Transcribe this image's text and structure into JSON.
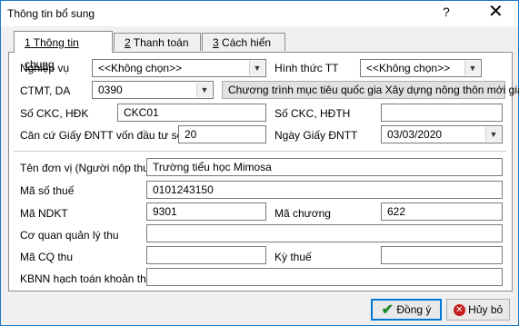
{
  "window": {
    "title": "Thông tin bổ sung",
    "help_glyph": "?",
    "close_glyph": "✕"
  },
  "tabs": [
    {
      "num": "1",
      "label": " Thông tin chung"
    },
    {
      "num": "2",
      "label": " Thanh toán"
    },
    {
      "num": "3",
      "label": " Cách hiển thị"
    }
  ],
  "form": {
    "nghiep_vu": {
      "label": "Nghiệp vụ",
      "value": "<<Không chọn>>"
    },
    "hinh_thuc_tt": {
      "label": "Hình thức TT",
      "value": "<<Không chọn>>"
    },
    "ctmt_da": {
      "label": "CTMT, DA",
      "value": "0390",
      "desc": "Chương trình mục tiêu quốc gia Xây dựng nông thôn mới gia"
    },
    "so_ckc_hdk": {
      "label": "Số CKC, HĐK",
      "value": "CKC01"
    },
    "so_ckc_hdth": {
      "label": "Số CKC, HĐTH",
      "value": ""
    },
    "can_cu": {
      "label": "Căn cứ Giấy ĐNTT vốn đầu tư số",
      "value": "20"
    },
    "ngay_giay": {
      "label": "Ngày Giấy ĐNTT",
      "value": "03/03/2020"
    },
    "ten_don_vi": {
      "label": "Tên đơn vị (Người nộp thuế)",
      "value": "Trường tiểu học Mimosa"
    },
    "ma_so_thue": {
      "label": "Mã số thuế",
      "value": "0101243150"
    },
    "ma_ndkt": {
      "label": "Mã NDKT",
      "value": "9301"
    },
    "ma_chuong": {
      "label": "Mã chương",
      "value": "622"
    },
    "co_quan": {
      "label": "Cơ quan quản lý thu",
      "value": ""
    },
    "ma_cq_thu": {
      "label": "Mã CQ thu",
      "value": ""
    },
    "ky_thue": {
      "label": "Kỳ thuế",
      "value": ""
    },
    "kbnn": {
      "label": "KBNN hạch toán khoản thu",
      "value": ""
    }
  },
  "buttons": {
    "ok": "Đồng ý",
    "cancel": "Hủy bỏ"
  },
  "colors": {
    "ok_icon": "#1e8a2e",
    "cancel_icon": "#c41e1e",
    "accent": "#0078d7"
  }
}
